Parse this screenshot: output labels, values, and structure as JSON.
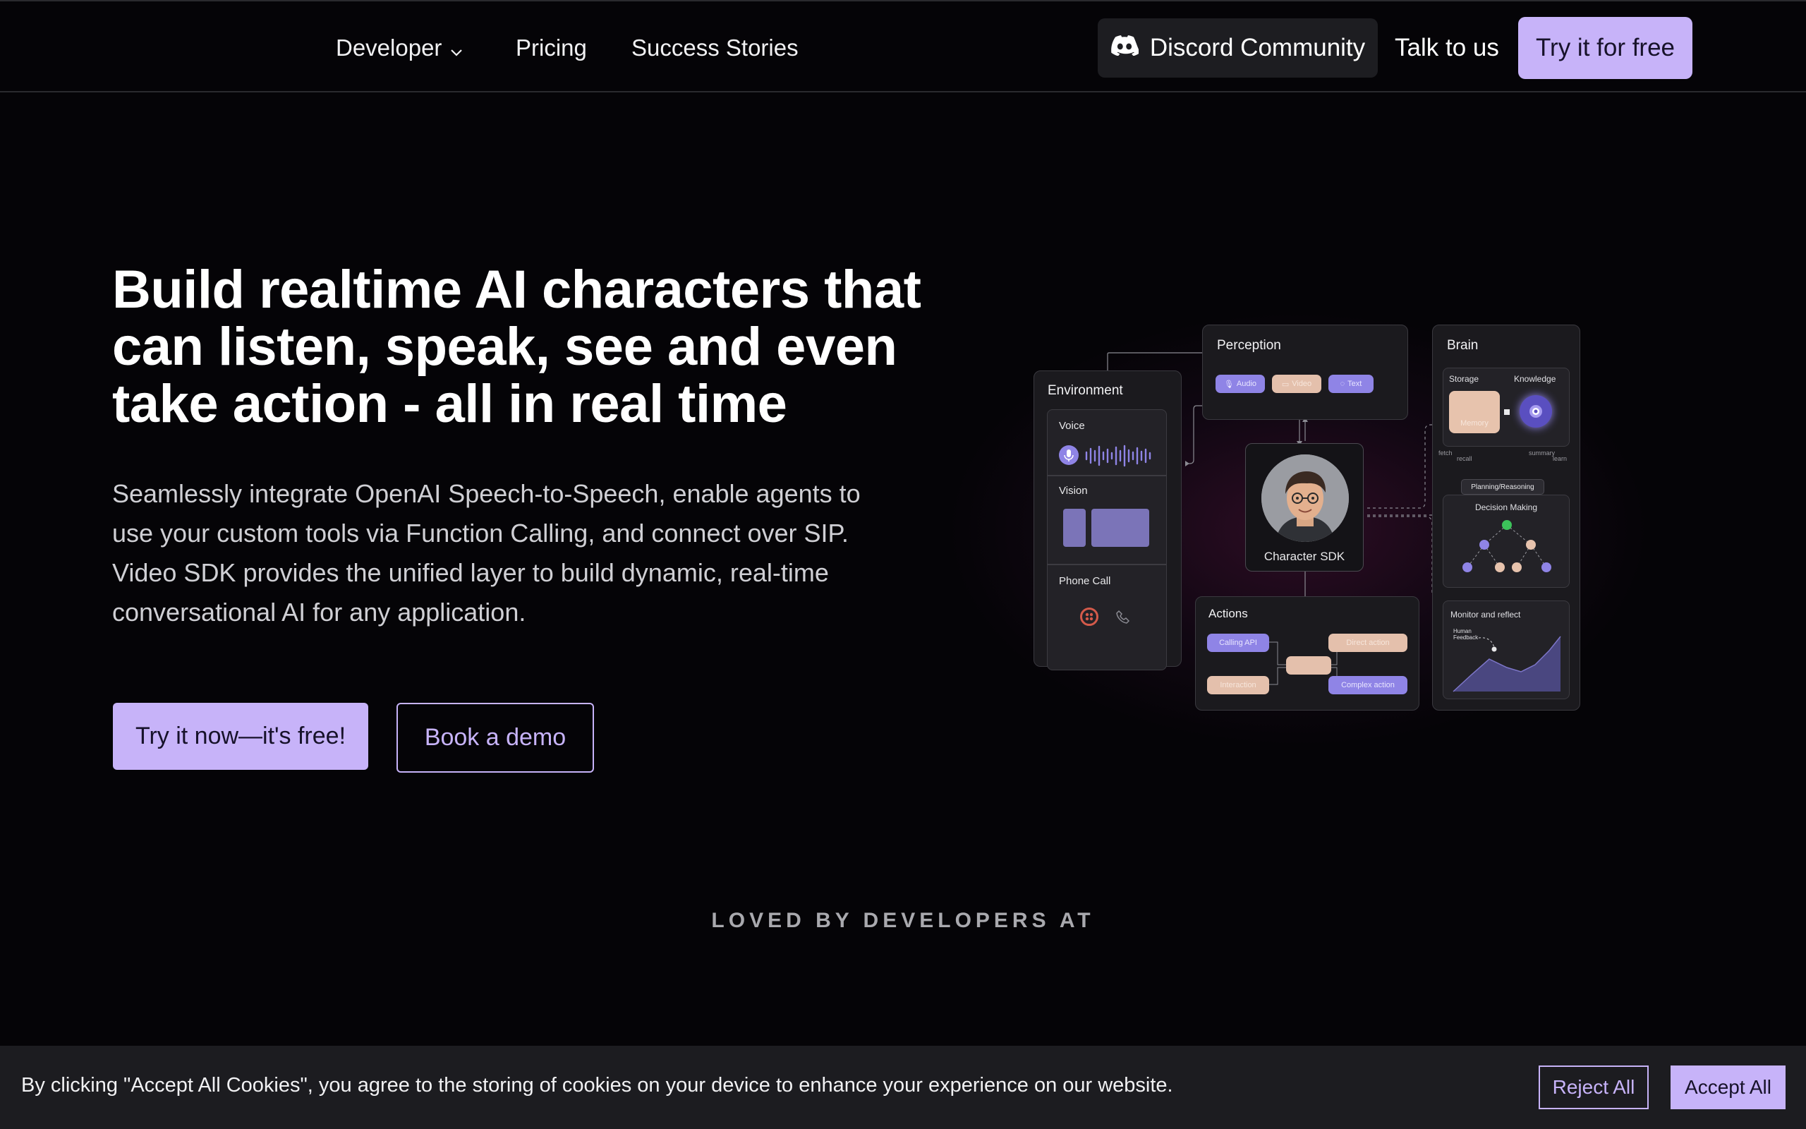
{
  "nav": {
    "developer_label": "Developer",
    "pricing_label": "Pricing",
    "success_label": "Success Stories",
    "discord_label": "Discord Community",
    "talk_label": "Talk to us",
    "try_free_label": "Try it for free"
  },
  "hero": {
    "title": "Build realtime AI characters that can listen, speak, see and even take action - all in real time",
    "description": "Seamlessly integrate OpenAI Speech-to-Speech, enable agents to use your custom tools via Function Calling, and connect over SIP. Video SDK provides the unified layer to build dynamic, real-time conversational AI for any application.",
    "primary_cta": "Try it now—it's free!",
    "secondary_cta": "Book a demo"
  },
  "diagram": {
    "environment": {
      "title": "Environment",
      "voice": "Voice",
      "vision": "Vision",
      "phone": "Phone Call"
    },
    "perception": {
      "title": "Perception",
      "chips": [
        "Audio",
        "Video",
        "Text"
      ]
    },
    "character": {
      "label": "Character SDK"
    },
    "actions": {
      "title": "Actions",
      "chips": [
        "Calling API",
        "Direct action",
        "Interaction",
        "Complex action"
      ]
    },
    "brain": {
      "title": "Brain",
      "storage": "Storage",
      "knowledge": "Knowledge",
      "memory": "Memory",
      "fetch": "fetch",
      "recall": "recall",
      "summary": "summary",
      "learn": "learn",
      "planning": "Planning/Reasoning",
      "decision": "Decision Making",
      "monitor": "Monitor and reflect",
      "human_feedback": "Human Feedback"
    }
  },
  "loved_by": "LOVED BY DEVELOPERS AT",
  "cookie": {
    "text": "By clicking \"Accept All Cookies\", you agree to the storing of cookies on your device to enhance your experience on our website.",
    "reject_label": "Reject All",
    "accept_label": "Accept All"
  },
  "colors": {
    "background": "#050407",
    "accent": "#c7b3f9",
    "panel": "#1b1a1e"
  },
  "icons": {
    "discord": "discord-icon",
    "developer_dropdown": "chevron-down-icon"
  }
}
